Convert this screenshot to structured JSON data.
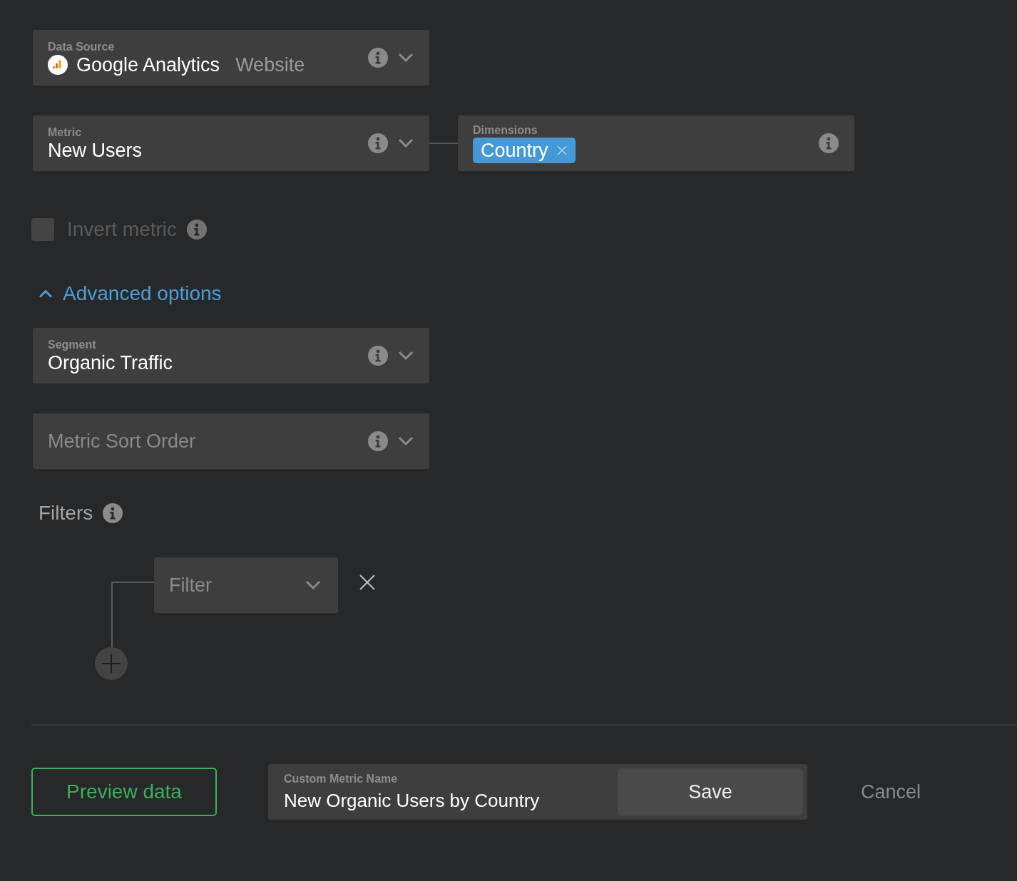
{
  "data_source": {
    "label": "Data Source",
    "value": "Google Analytics",
    "detail": "Website"
  },
  "metric": {
    "label": "Metric",
    "value": "New Users"
  },
  "dimensions": {
    "label": "Dimensions",
    "tags": [
      "Country"
    ]
  },
  "invert_metric": {
    "label": "Invert metric",
    "checked": false,
    "disabled": true
  },
  "advanced_options": {
    "label": "Advanced options",
    "expanded": true
  },
  "segment": {
    "label": "Segment",
    "value": "Organic Traffic"
  },
  "metric_sort_order": {
    "placeholder": "Metric Sort Order"
  },
  "filters": {
    "label": "Filters",
    "items": [
      {
        "placeholder": "Filter"
      }
    ]
  },
  "preview_button": "Preview data",
  "custom_metric_name": {
    "label": "Custom Metric Name",
    "value": "New Organic Users by Country"
  },
  "save_button": "Save",
  "cancel_button": "Cancel"
}
